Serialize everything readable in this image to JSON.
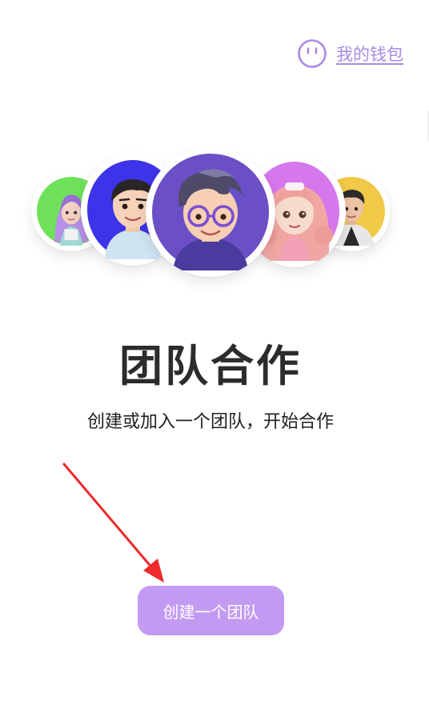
{
  "header": {
    "wallet_label": "我的钱包",
    "wallet_icon": "smiley-face-icon"
  },
  "hero": {
    "title": "团队合作",
    "subtitle": "创建或加入一个团队，开始合作"
  },
  "actions": {
    "create_team_label": "创建一个团队"
  },
  "colors": {
    "accent": "#c39af2",
    "link": "#a98ae6",
    "avatar_backgrounds": [
      "#6fe05a",
      "#3d33e8",
      "#6b4fc6",
      "#d677ec",
      "#f1c947"
    ]
  }
}
